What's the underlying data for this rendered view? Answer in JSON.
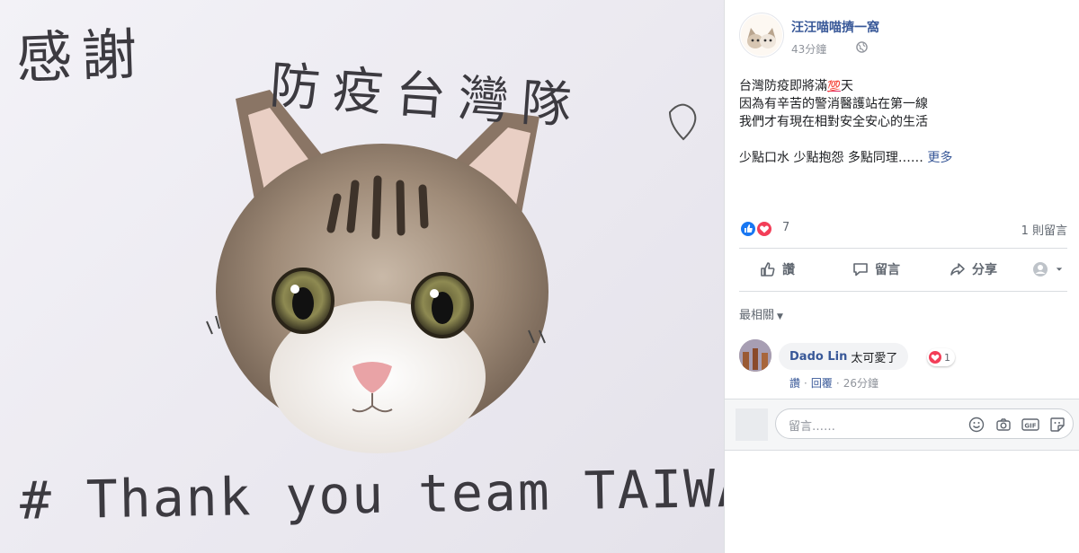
{
  "photo": {
    "handwriting_top_left": "感謝",
    "handwriting_top_right": "防疫台灣隊",
    "handwriting_bottom": "# Thank you team TAIWAN!"
  },
  "post": {
    "page_name": "汪汪喵喵擠一窩",
    "timestamp": "43分鐘",
    "lines": [
      "台灣防疫即將滿",
      "天",
      "因為有辛苦的警消醫護站在第一線",
      "我們才有現在相對安全安心的生活",
      "少點口水 少點抱怨 多點同理……"
    ],
    "hundred_emoji": "💯",
    "more_label": "更多",
    "reaction_count": "7",
    "comment_count": "1 則留言",
    "actions": {
      "like": "讚",
      "comment": "留言",
      "share": "分享"
    },
    "sort_label": "最相關"
  },
  "comment": {
    "author": "Dado Lin",
    "text": "太可愛了",
    "reaction_count": "1",
    "like_label": "讚",
    "reply_label": "回覆",
    "time": "26分鐘"
  },
  "composer": {
    "placeholder": "留言……"
  },
  "icons": {
    "globe": "globe-icon",
    "like": "thumbs-up-icon",
    "comment": "speech-bubble-icon",
    "share": "share-arrow-icon",
    "emoji": "smiley-icon",
    "camera": "camera-icon",
    "gif": "gif-icon",
    "sticker": "sticker-icon"
  },
  "colors": {
    "link": "#385898",
    "like_blue": "#1877f2",
    "love_red": "#f33e58"
  }
}
